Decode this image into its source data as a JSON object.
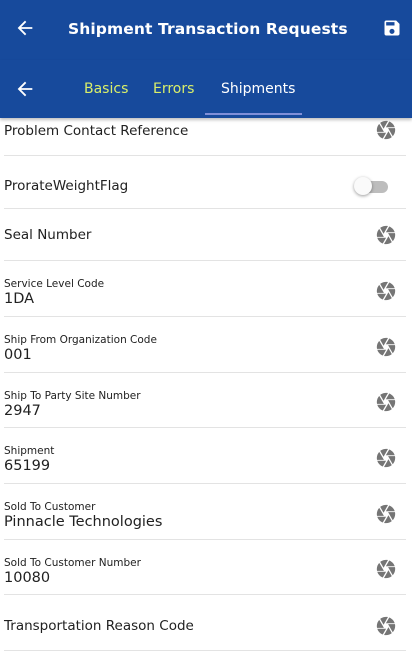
{
  "header": {
    "title": "Shipment Transaction Requests"
  },
  "tabs": [
    {
      "label": "Basics"
    },
    {
      "label": "Errors"
    },
    {
      "label": "Shipments"
    }
  ],
  "fields": [
    {
      "label": "Problem Contact Reference",
      "value": ""
    },
    {
      "label": "ProrateWeightFlag",
      "toggle_on": false
    },
    {
      "label": "Seal Number",
      "value": ""
    },
    {
      "label": "Service Level Code",
      "value": "1DA"
    },
    {
      "label": "Ship From Organization Code",
      "value": "001"
    },
    {
      "label": "Ship To Party Site Number",
      "value": "2947"
    },
    {
      "label": "Shipment",
      "value": "65199"
    },
    {
      "label": "Sold To Customer",
      "value": "Pinnacle Technologies"
    },
    {
      "label": "Sold To Customer Number",
      "value": "10080"
    },
    {
      "label": "Transportation Reason Code",
      "value": ""
    }
  ],
  "icons": {
    "back": "arrow-left-icon",
    "save": "save-icon",
    "field": "aperture-icon"
  },
  "colors": {
    "appbar": "#174a9c",
    "tab_inactive": "#d9ef6a",
    "tab_active": "#ffffff",
    "indicator": "#7f8fd8"
  }
}
